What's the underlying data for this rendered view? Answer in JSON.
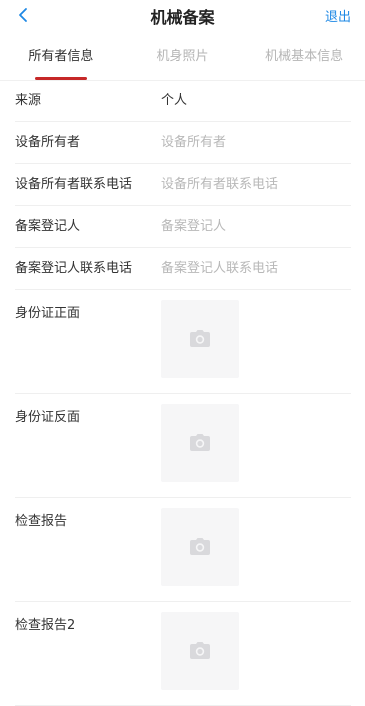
{
  "header": {
    "title": "机械备案",
    "exit_label": "退出",
    "back_icon": "chevron-left-icon",
    "accent_color": "#1e88e5"
  },
  "tabs": [
    {
      "label": "所有者信息",
      "active": true
    },
    {
      "label": "机身照片",
      "active": false
    },
    {
      "label": "机械基本信息",
      "active": false
    }
  ],
  "tab_underline_color": "#c62828",
  "form": {
    "source": {
      "label": "来源",
      "value": "个人"
    },
    "owner": {
      "label": "设备所有者",
      "placeholder": "设备所有者"
    },
    "owner_phone": {
      "label": "设备所有者联系电话",
      "placeholder": "设备所有者联系电话"
    },
    "registrant": {
      "label": "备案登记人",
      "placeholder": "备案登记人"
    },
    "registrant_phone": {
      "label": "备案登记人联系电话",
      "placeholder": "备案登记人联系电话"
    }
  },
  "photos": [
    {
      "label": "身份证正面",
      "icon": "camera-icon"
    },
    {
      "label": "身份证反面",
      "icon": "camera-icon"
    },
    {
      "label": "检查报告",
      "icon": "camera-icon"
    },
    {
      "label": "检查报告2",
      "icon": "camera-icon"
    }
  ]
}
